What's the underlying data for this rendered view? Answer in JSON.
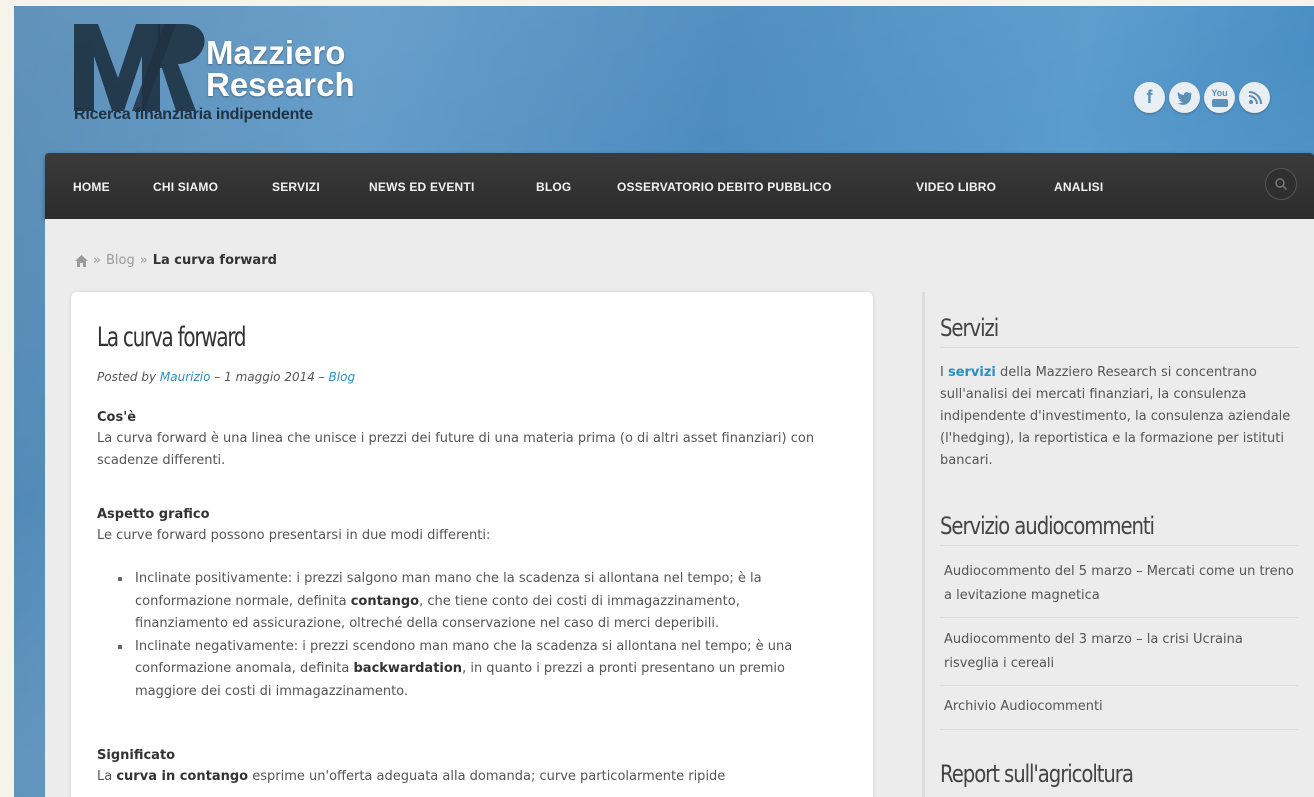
{
  "brand": {
    "name_line1": "Mazziero",
    "name_line2": "Research",
    "tagline": "Ricerca finanziaria indipendente",
    "colors": {
      "header_blue": "#4f86b2",
      "nav_dark": "#333333",
      "link_blue": "#2a8fc7"
    }
  },
  "social": [
    {
      "icon": "facebook-icon",
      "glyph": "f"
    },
    {
      "icon": "twitter-icon",
      "glyph": "t"
    },
    {
      "icon": "youtube-icon",
      "glyph": "You"
    },
    {
      "icon": "rss-icon",
      "glyph": "rss"
    }
  ],
  "nav": {
    "items": [
      "HOME",
      "CHI SIAMO",
      "SERVIZI",
      "NEWS ED EVENTI",
      "BLOG",
      "OSSERVATORIO DEBITO PUBBLICO",
      "VIDEO LIBRO",
      "ANALISI"
    ],
    "search_icon": "search-icon"
  },
  "breadcrumb": {
    "home_icon": "home-icon",
    "parent": "Blog",
    "current": "La curva forward",
    "sep": "»"
  },
  "post": {
    "title": "La curva forward",
    "meta_prefix": "Posted by",
    "author": "Maurizio",
    "date_sep": "–",
    "date": "1 maggio 2014",
    "category_sep": "–",
    "category": "Blog",
    "s1_heading": "Cos'è",
    "s1_text": "La curva forward è una linea che unisce i prezzi dei future di una materia prima (o di altri asset finanziari) con scadenze differenti.",
    "s2_heading": "Aspetto grafico",
    "s2_text": "Le curve forward possono presentarsi in due modi differenti:",
    "b1_pre": "Inclinate positivamente: i prezzi salgono man mano che la scadenza si allontana nel tempo; è la conformazione normale, definita ",
    "b1_bold": "contango",
    "b1_post": ", che tiene conto dei costi di immagazzinamento, finanziamento ed assicurazione, oltreché della conservazione nel caso di merci deperibili.",
    "b2_pre": "Inclinate negativamente: i prezzi scendono man mano che la scadenza si allontana nel tempo; è una conformazione anomala, definita ",
    "b2_bold": "backwardation",
    "b2_post": ", in quanto i prezzi a pronti presentano un premio maggiore dei costi di immagazzinamento.",
    "s3_heading": "Significato",
    "s3_pre": "La ",
    "s3_bold": "curva in contango",
    "s3_post": " esprime un'offerta adeguata alla domanda; curve particolarmente ripide"
  },
  "sidebar": {
    "w1_title": "Servizi",
    "w1_pre": "I ",
    "w1_link": "servizi",
    "w1_post": " della Mazziero Research si concentrano sull'analisi dei mercati finanziari, la consulenza indipendente d'investimento, la consulenza aziendale (l'hedging), la reportistica e la formazione per istituti bancari.",
    "w2_title": "Servizio audiocommenti",
    "w2_items": [
      "Audiocommento del 5 marzo – Mercati come un treno a levitazione magnetica",
      "Audiocommento del 3 marzo – la crisi Ucraina risveglia i cereali",
      "Archivio Audiocommenti"
    ],
    "w3_title": "Report sull'agricoltura"
  }
}
